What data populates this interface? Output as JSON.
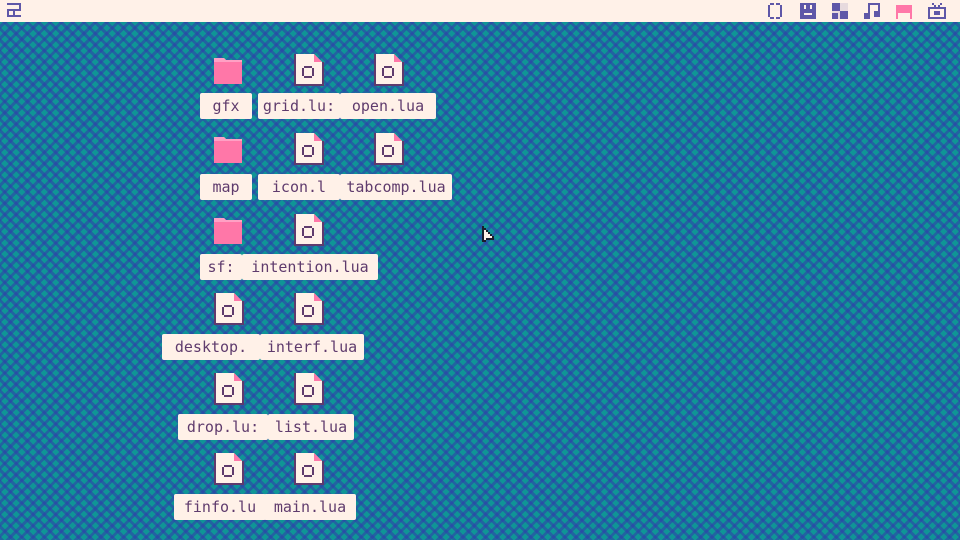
{
  "topbar": {
    "app_icon": "app-menu-icon",
    "tools": [
      {
        "name": "code-editor-icon"
      },
      {
        "name": "sprite-editor-icon"
      },
      {
        "name": "map-editor-icon"
      },
      {
        "name": "sfx-editor-icon"
      },
      {
        "name": "music-editor-icon"
      },
      {
        "name": "run-icon"
      }
    ]
  },
  "desktop": {
    "items": [
      {
        "label": "gfx",
        "kind": "folder"
      },
      {
        "label": "grid.lu:",
        "kind": "file"
      },
      {
        "label": "open.lua",
        "kind": "file"
      },
      {
        "label": "map",
        "kind": "folder"
      },
      {
        "label": "icon.l",
        "kind": "file"
      },
      {
        "label": "tabcomp.lua",
        "kind": "file"
      },
      {
        "label": "sf:",
        "kind": "folder"
      },
      {
        "label": "intention.lua",
        "kind": "file"
      },
      {
        "label": "desktop.",
        "kind": "file"
      },
      {
        "label": "interf.lua",
        "kind": "file"
      },
      {
        "label": "drop.lu:",
        "kind": "file"
      },
      {
        "label": "list.lua",
        "kind": "file"
      },
      {
        "label": "finfo.lu",
        "kind": "file"
      },
      {
        "label": "main.lua",
        "kind": "file"
      }
    ]
  },
  "colors": {
    "background": "#0f9596",
    "pattern": "#303caa",
    "panel": "#fff1e8",
    "label_text": "#5f3b6d",
    "folder": "#ff77a8",
    "accent": "#ff77a8"
  }
}
